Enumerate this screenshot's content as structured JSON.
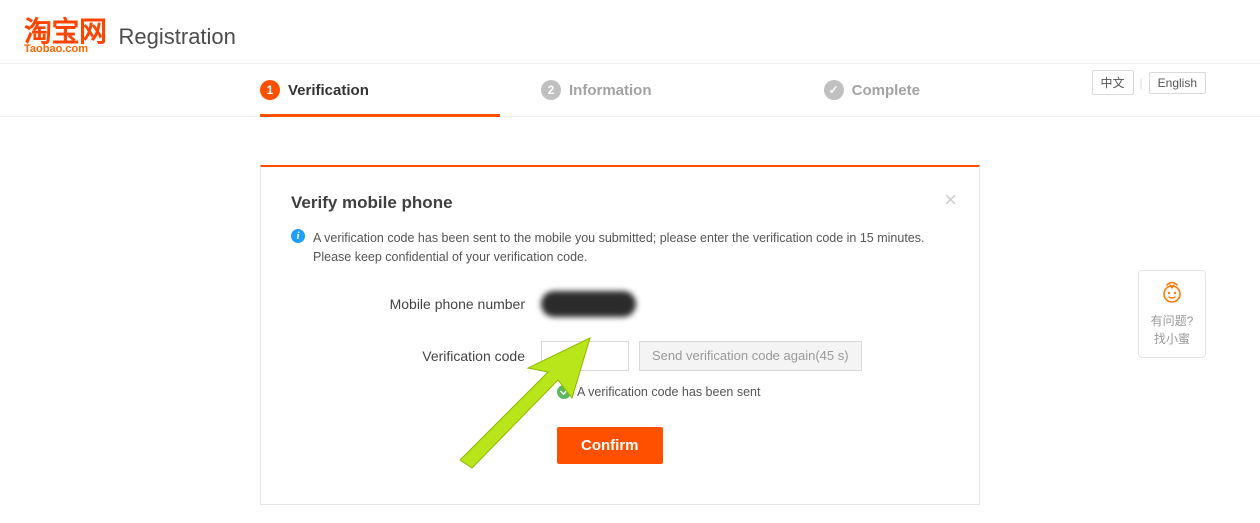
{
  "brand": {
    "main": "淘宝网",
    "sub": "Taobao.com"
  },
  "header": {
    "title": "Registration"
  },
  "steps": {
    "s1": {
      "num": "1",
      "label": "Verification"
    },
    "s2": {
      "num": "2",
      "label": "Information"
    },
    "s3": {
      "num": "✓",
      "label": "Complete"
    }
  },
  "lang": {
    "zh": "中文",
    "en": "English"
  },
  "panel": {
    "title": "Verify mobile phone",
    "notice": "A verification code has been sent to the mobile you submitted; please enter the verification code in 15 minutes. Please keep confidential of your verification code.",
    "label_phone": "Mobile phone number",
    "label_code": "Verification code",
    "resend": "Send verification code again(45 s)",
    "sent_msg": "A verification code has been sent",
    "confirm": "Confirm"
  },
  "help": {
    "line1": "有问题?",
    "line2": "找小蜜"
  },
  "colors": {
    "accent": "#ff5000"
  }
}
